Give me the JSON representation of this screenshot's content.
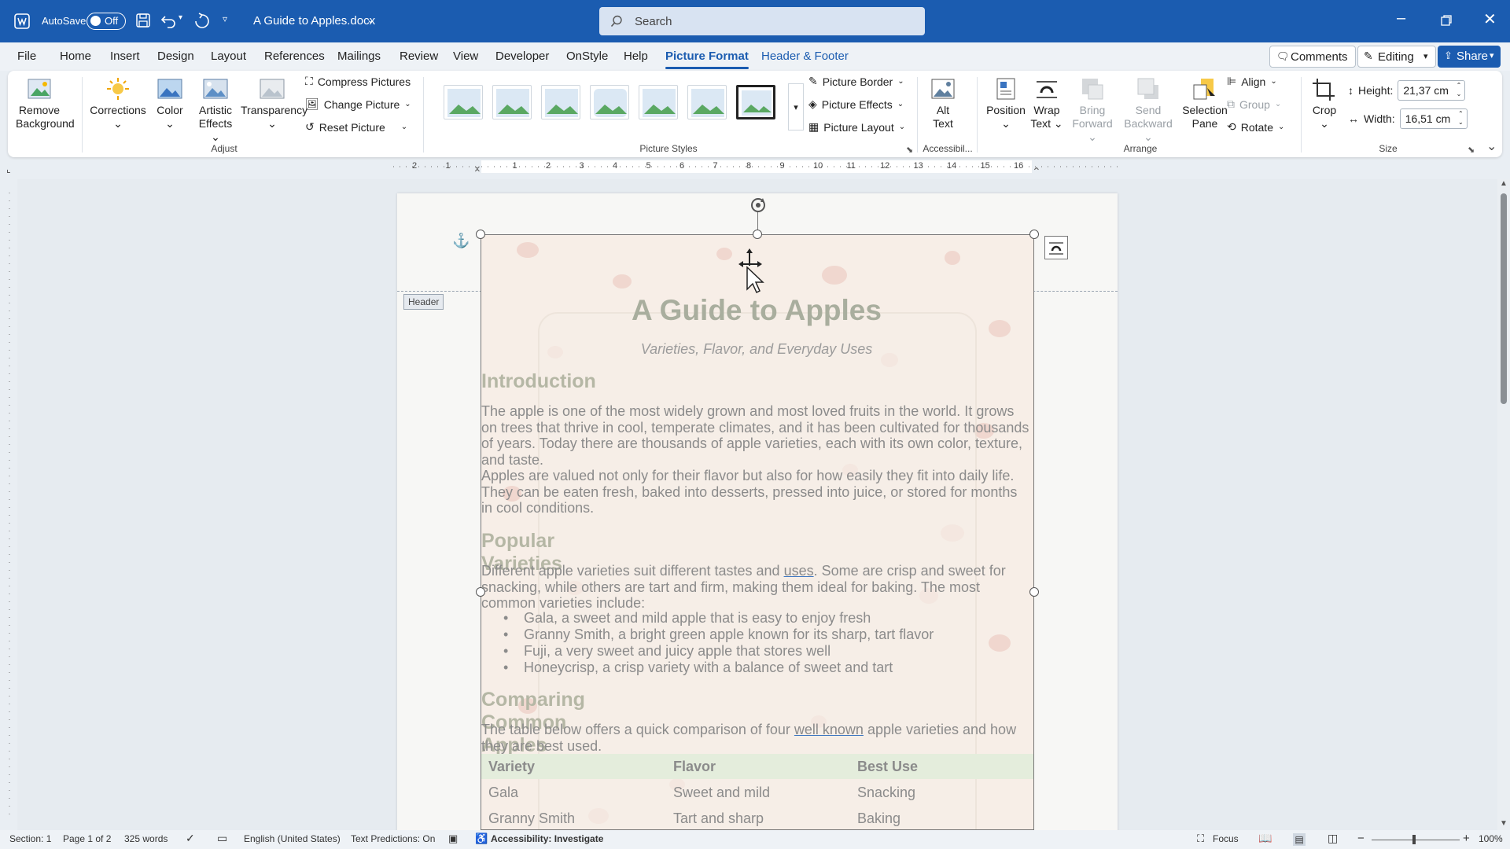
{
  "titlebar": {
    "autosave": "AutoSave",
    "autosave_state": "Off",
    "doc_title": "A Guide to Apples.docx",
    "search_placeholder": "Search"
  },
  "tabs": [
    "File",
    "Home",
    "Insert",
    "Design",
    "Layout",
    "References",
    "Mailings",
    "Review",
    "View",
    "Developer",
    "OnStyle",
    "Help",
    "Picture Format",
    "Header & Footer"
  ],
  "active_tab": "Picture Format",
  "top_right": {
    "comments": "Comments",
    "editing": "Editing",
    "share": "Share"
  },
  "ribbon": {
    "adjust": {
      "remove_background": [
        "Remove",
        "Background"
      ],
      "corrections": "Corrections",
      "color": "Color",
      "artistic_effects": [
        "Artistic",
        "Effects"
      ],
      "transparency": "Transparency",
      "compress": "Compress Pictures",
      "change": "Change Picture",
      "reset": "Reset Picture",
      "group": "Adjust"
    },
    "styles": {
      "border": "Picture Border",
      "effects": "Picture Effects",
      "layout": "Picture Layout",
      "group": "Picture Styles"
    },
    "accessibility": {
      "alt_text": [
        "Alt",
        "Text"
      ],
      "group": "Accessibil..."
    },
    "arrange": {
      "position": "Position",
      "wrap_text": [
        "Wrap",
        "Text"
      ],
      "bring_forward": [
        "Bring",
        "Forward"
      ],
      "send_backward": [
        "Send",
        "Backward"
      ],
      "selection_pane": [
        "Selection",
        "Pane"
      ],
      "align": "Align",
      "group_btn": "Group",
      "rotate": "Rotate",
      "group": "Arrange"
    },
    "size": {
      "crop": "Crop",
      "height_label": "Height:",
      "height_value": "21,37 cm",
      "width_label": "Width:",
      "width_value": "16,51 cm",
      "group": "Size"
    }
  },
  "ruler_numbers": [
    "2",
    "1",
    "1",
    "2",
    "3",
    "4",
    "5",
    "6",
    "7",
    "8",
    "9",
    "10",
    "11",
    "12",
    "13",
    "14",
    "15",
    "16"
  ],
  "header_tag": "Header",
  "document": {
    "title": "A Guide to Apples",
    "subtitle": "Varieties, Flavor, and Everyday Uses",
    "h_intro": "Introduction",
    "p_intro1": "The apple is one of the most widely grown and most loved fruits in the world. It grows on trees that thrive in cool, temperate climates, and it has been cultivated for thousands of years. Today there are thousands of apple varieties, each with its own color, texture, and taste.",
    "p_intro2": "Apples are valued not only for their flavor but also for how easily they fit into daily life. They can be eaten fresh, baked into desserts, pressed into juice, or stored for months in cool conditions.",
    "h_varieties": "Popular Varieties",
    "p_var_a": "Different apple varieties suit different tastes and ",
    "p_var_link": "uses",
    "p_var_b": ". Some are crisp and sweet for snacking, while others are tart and firm, making them ideal for baking. The most common varieties include:",
    "bullets": [
      "Gala, a sweet and mild apple that is easy to enjoy fresh",
      "Granny Smith, a bright green apple known for its sharp, tart flavor",
      "Fuji, a very sweet and juicy apple that stores well",
      "Honeycrisp, a crisp variety with a balance of sweet and tart"
    ],
    "h_compare": "Comparing Common Apples",
    "p_cmp_a": "The table below offers a quick comparison of four ",
    "p_cmp_link": "well known",
    "p_cmp_b": " apple varieties and how they are best used.",
    "table": {
      "headers": [
        "Variety",
        "Flavor",
        "Best Use"
      ],
      "rows": [
        [
          "Gala",
          "Sweet and mild",
          "Snacking"
        ],
        [
          "Granny Smith",
          "Tart and sharp",
          "Baking"
        ]
      ]
    }
  },
  "status": {
    "section": "Section: 1",
    "page": "Page 1 of 2",
    "words": "325 words",
    "language": "English (United States)",
    "predictions": "Text Predictions: On",
    "accessibility": "Accessibility: Investigate",
    "focus": "Focus",
    "zoom": "100%"
  }
}
